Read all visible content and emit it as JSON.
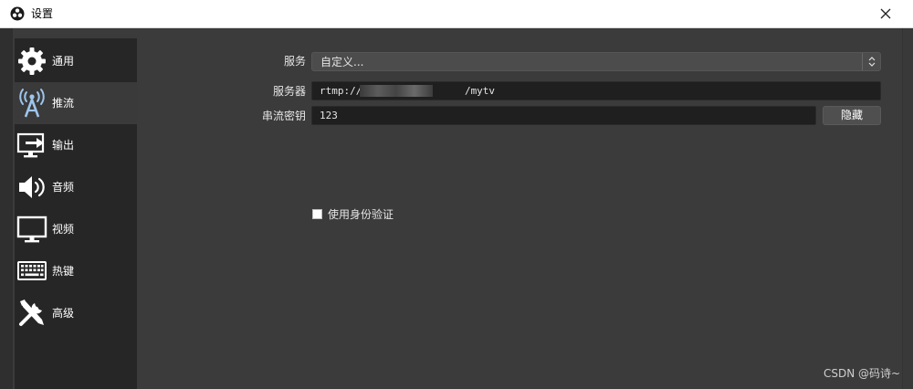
{
  "window": {
    "title": "设置",
    "close_icon": "close-icon",
    "app_icon": "obs-logo-icon"
  },
  "sidebar": {
    "items": [
      {
        "label": "通用",
        "icon": "gear-icon",
        "active": false
      },
      {
        "label": "推流",
        "icon": "broadcast-icon",
        "active": true
      },
      {
        "label": "输出",
        "icon": "output-icon",
        "active": false
      },
      {
        "label": "音频",
        "icon": "speaker-icon",
        "active": false
      },
      {
        "label": "视频",
        "icon": "monitor-icon",
        "active": false
      },
      {
        "label": "热键",
        "icon": "keyboard-icon",
        "active": false
      },
      {
        "label": "高级",
        "icon": "tools-icon",
        "active": false
      }
    ]
  },
  "stream": {
    "service_label": "服务",
    "service_value": "自定义...",
    "server_label": "服务器",
    "server_value": "rtmp://1                /mytv",
    "key_label": "串流密钥",
    "key_value": "123",
    "hide_button": "隐藏",
    "auth_checkbox": "使用身份验证",
    "auth_checked": false
  },
  "watermark": "CSDN @码诗~",
  "colors": {
    "background": "#3b3b3b",
    "sidebar": "#262626",
    "input": "#1f1f1f",
    "titlebar": "#ffffff"
  }
}
